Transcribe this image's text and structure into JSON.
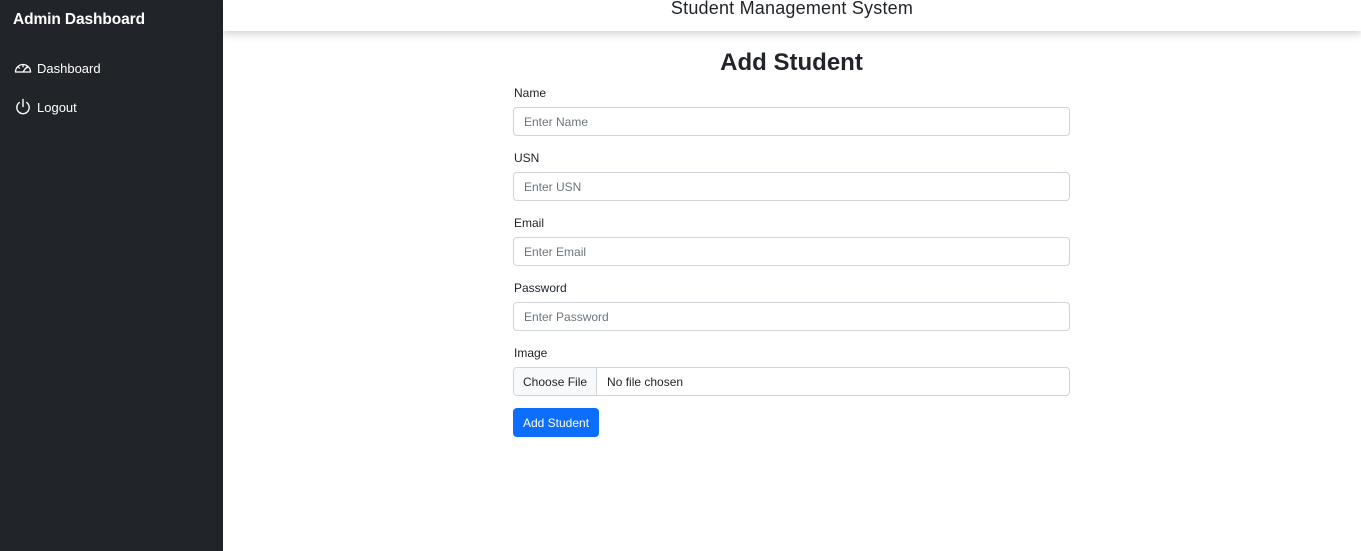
{
  "sidebar": {
    "brand": "Admin Dashboard",
    "items": [
      {
        "label": "Dashboard",
        "icon": "speedometer-icon"
      },
      {
        "label": "Logout",
        "icon": "power-icon"
      }
    ]
  },
  "header": {
    "title": "Student Management System"
  },
  "form": {
    "title": "Add Student",
    "fields": {
      "name": {
        "label": "Name",
        "placeholder": "Enter Name",
        "value": ""
      },
      "usn": {
        "label": "USN",
        "placeholder": "Enter USN",
        "value": ""
      },
      "email": {
        "label": "Email",
        "placeholder": "Enter Email",
        "value": ""
      },
      "password": {
        "label": "Password",
        "placeholder": "Enter Password",
        "value": ""
      },
      "image": {
        "label": "Image",
        "button_label": "Choose File",
        "status": "No file chosen"
      }
    },
    "submit_label": "Add Student"
  },
  "colors": {
    "sidebar_bg": "#212529",
    "primary": "#0d6efd",
    "border": "#ced4da"
  }
}
